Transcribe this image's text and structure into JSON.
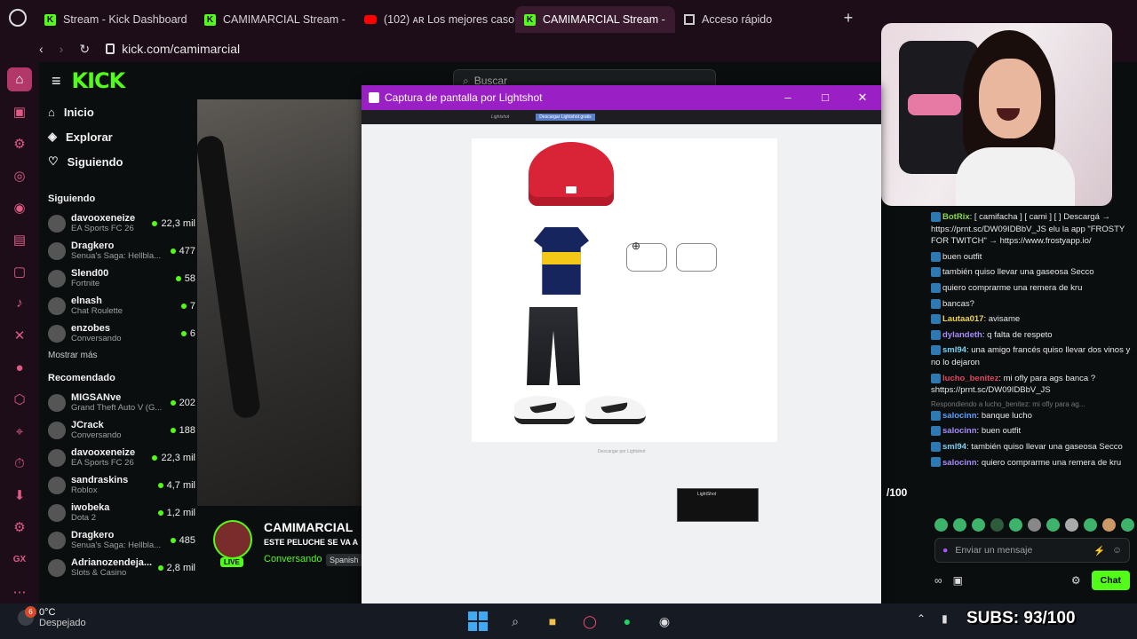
{
  "browser": {
    "tabs": [
      {
        "label": "Stream - Kick Dashboard",
        "icon": "kick"
      },
      {
        "label": "CAMIMARCIAL Stream - ",
        "icon": "kick"
      },
      {
        "label": "(102) ᴀʀ Los mejores caso",
        "icon": "youtube"
      },
      {
        "label": "CAMIMARCIAL Stream - ",
        "icon": "kick",
        "active": true
      },
      {
        "label": "Acceso rápido",
        "icon": "grid"
      }
    ],
    "url": "kick.com/camimarcial"
  },
  "kick": {
    "logo": "KICK",
    "search_placeholder": "Buscar",
    "nav": {
      "home": "Inicio",
      "explore": "Explorar",
      "following": "Siguiendo"
    },
    "following_title": "Siguiendo",
    "following": [
      {
        "name": "davooxeneize",
        "category": "EA Sports FC 26",
        "viewers": "22,3 mil"
      },
      {
        "name": "Dragkero",
        "category": "Senua's Saga: Hellbla...",
        "viewers": "477"
      },
      {
        "name": "Slend00",
        "category": "Fortnite",
        "viewers": "58"
      },
      {
        "name": "elnash",
        "category": "Chat Roulette",
        "viewers": "7"
      },
      {
        "name": "enzobes",
        "category": "Conversando",
        "viewers": "6"
      }
    ],
    "show_more": "Mostrar más",
    "recommended_title": "Recomendado",
    "recommended": [
      {
        "name": "MIGSANve",
        "category": "Grand Theft Auto V (G...",
        "viewers": "202"
      },
      {
        "name": "JCrack",
        "category": "Conversando",
        "viewers": "188"
      },
      {
        "name": "davooxeneize",
        "category": "EA Sports FC 26",
        "viewers": "22,3 mil"
      },
      {
        "name": "sandraskins",
        "category": "Roblox",
        "viewers": "4,7 mil"
      },
      {
        "name": "iwobeka",
        "category": "Dota 2",
        "viewers": "1,2 mil"
      },
      {
        "name": "Dragkero",
        "category": "Senua's Saga: Hellbla...",
        "viewers": "485"
      },
      {
        "name": "Adrianozendeja...",
        "category": "Slots & Casino",
        "viewers": "2,8 mil"
      }
    ],
    "stream": {
      "name": "CAMIMARCIAL",
      "title": "ESTE PELUCHE SE VA A",
      "category": "Conversando",
      "language": "Spanish",
      "live_badge": "LIVE"
    }
  },
  "lightshot": {
    "title": "Captura de pantalla por Lightshot",
    "header_cta": "Descargar Lightshot gratis",
    "under_text": "Descargar por Lightshot",
    "thumb_title": "LightShot"
  },
  "chat": {
    "lines": [
      {
        "user": "BotRix",
        "color": "u-green",
        "text": ": [ camifacha ] [ cami ] [ ] Descargá → https://prnt.sc/DW09IDBbV_JS elu la app \"FROSTY FOR TWITCH\" → https://www.frostyapp.io/"
      },
      {
        "user": "",
        "color": "",
        "text": "buen outfit"
      },
      {
        "user": "",
        "color": "",
        "text": "también quiso llevar una gaseosa Secco"
      },
      {
        "user": "",
        "color": "",
        "text": "quiero comprarme una remera de kru"
      },
      {
        "user": "",
        "color": "",
        "text": "bancas?"
      },
      {
        "user": "Lautaa017",
        "color": "u-yellow",
        "text": ": avisame"
      },
      {
        "user": "dylandeth",
        "color": "u-purple",
        "text": ": q falta de respeto"
      },
      {
        "user": "sml94",
        "color": "u-cyan",
        "text": ": una amigo francés quiso llevar dos vinos y no lo dejaron"
      },
      {
        "user": "lucho_benitez",
        "color": "u-red",
        "text": ": mi ofly para ags banca ? shttps://prnt.sc/DW09IDBbV_JS"
      },
      {
        "reply": "Respondiendo a lucho_benitez: mi ofly para ag..."
      },
      {
        "user": "salocinn",
        "color": "u-blue",
        "text": ": banque lucho"
      },
      {
        "user": "salocinn",
        "color": "u-purple",
        "text": ": buen outfit"
      },
      {
        "user": "sml94",
        "color": "u-cyan",
        "text": ": también quiso llevar una gaseosa Secco"
      },
      {
        "user": "salocinn",
        "color": "u-purple",
        "text": ": quiero comprarme una remera de kru"
      }
    ],
    "input_placeholder": "Enviar un mensaje",
    "send_label": "Chat",
    "goal_text": "/100"
  },
  "taskbar": {
    "temp": "0°C",
    "weather": "Despejado",
    "badge": "6"
  },
  "overlay": {
    "subs": "SUBS: 93/100"
  }
}
